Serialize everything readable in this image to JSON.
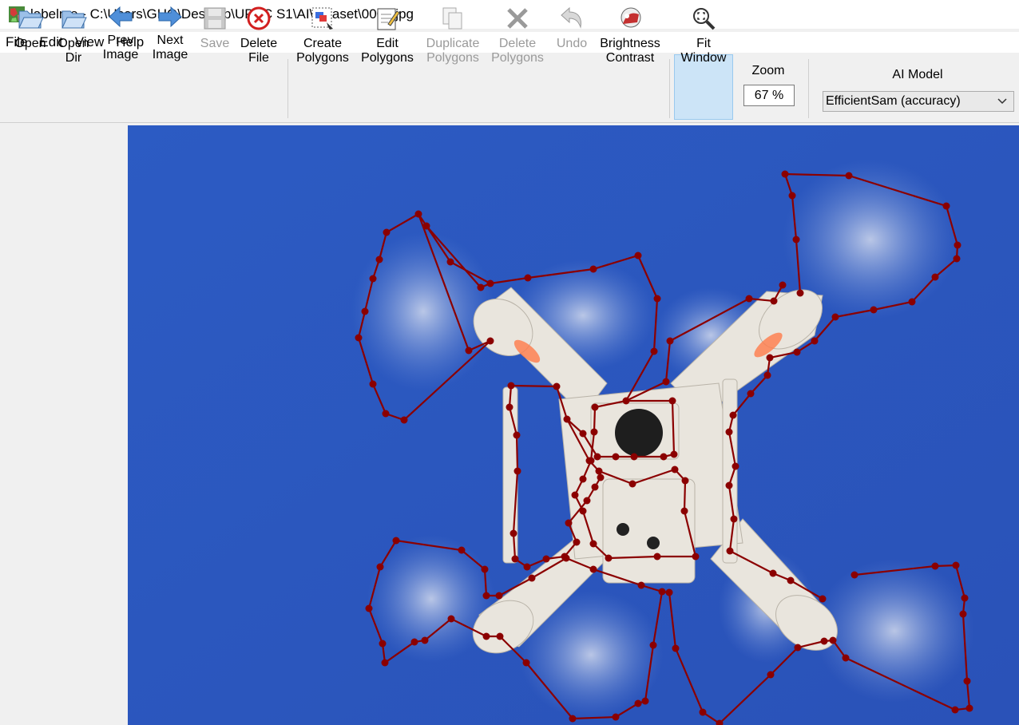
{
  "window": {
    "title": "labelme - C:\\Users\\GHO\\Desktop\\UPEC S1\\AI\\dataset\\0003.jpg"
  },
  "menu": [
    "File",
    "Edit",
    "View",
    "Help"
  ],
  "toolbar": {
    "open": "Open",
    "open_dir": "Open\nDir",
    "prev_image": "Prev\nImage",
    "next_image": "Next\nImage",
    "save": "Save",
    "delete_file": "Delete\nFile",
    "create_polygons": "Create\nPolygons",
    "edit_polygons": "Edit\nPolygons",
    "duplicate_polygons": "Duplicate\nPolygons",
    "delete_polygons": "Delete\nPolygons",
    "undo": "Undo",
    "brightness_contrast": "Brightness\nContrast",
    "fit_window": "Fit\nWindow"
  },
  "zoom": {
    "label": "Zoom",
    "value": "67 %"
  },
  "ai_model": {
    "label": "AI Model",
    "selected": "EfficientSam (accuracy)"
  },
  "colors": {
    "sky": "#2f5fc4",
    "polygon": "#8b0000",
    "drone": "#e8e4dc",
    "fit_active_bg": "#cce4f7"
  }
}
